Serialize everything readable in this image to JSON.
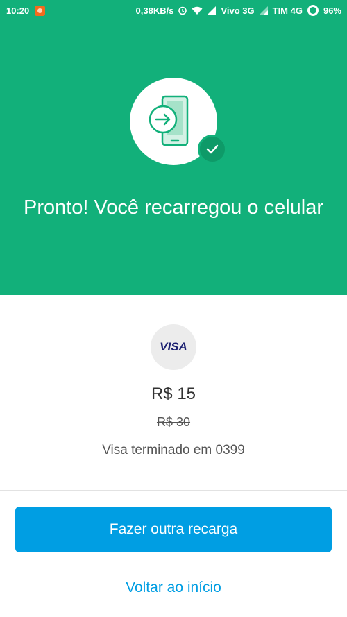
{
  "status_bar": {
    "time": "10:20",
    "network_speed": "0,38KB/s",
    "carrier1": "Vivo 3G",
    "carrier2": "TIM 4G",
    "battery": "96%",
    "icons": [
      "notification-app-icon",
      "alarm-icon",
      "wifi-icon",
      "signal-icon",
      "battery-ring-icon"
    ]
  },
  "hero": {
    "title": "Pronto! Você recarregou o celular",
    "icon": "phone-recharge-icon",
    "badge_icon": "check-icon",
    "background_color": "#12b07a"
  },
  "payment": {
    "card_brand": "VISA",
    "price": "R$ 15",
    "old_price": "R$ 30",
    "card_description": "Visa terminado em 0399"
  },
  "actions": {
    "primary_label": "Fazer outra recarga",
    "secondary_label": "Voltar ao início",
    "accent_color": "#009ee3"
  }
}
